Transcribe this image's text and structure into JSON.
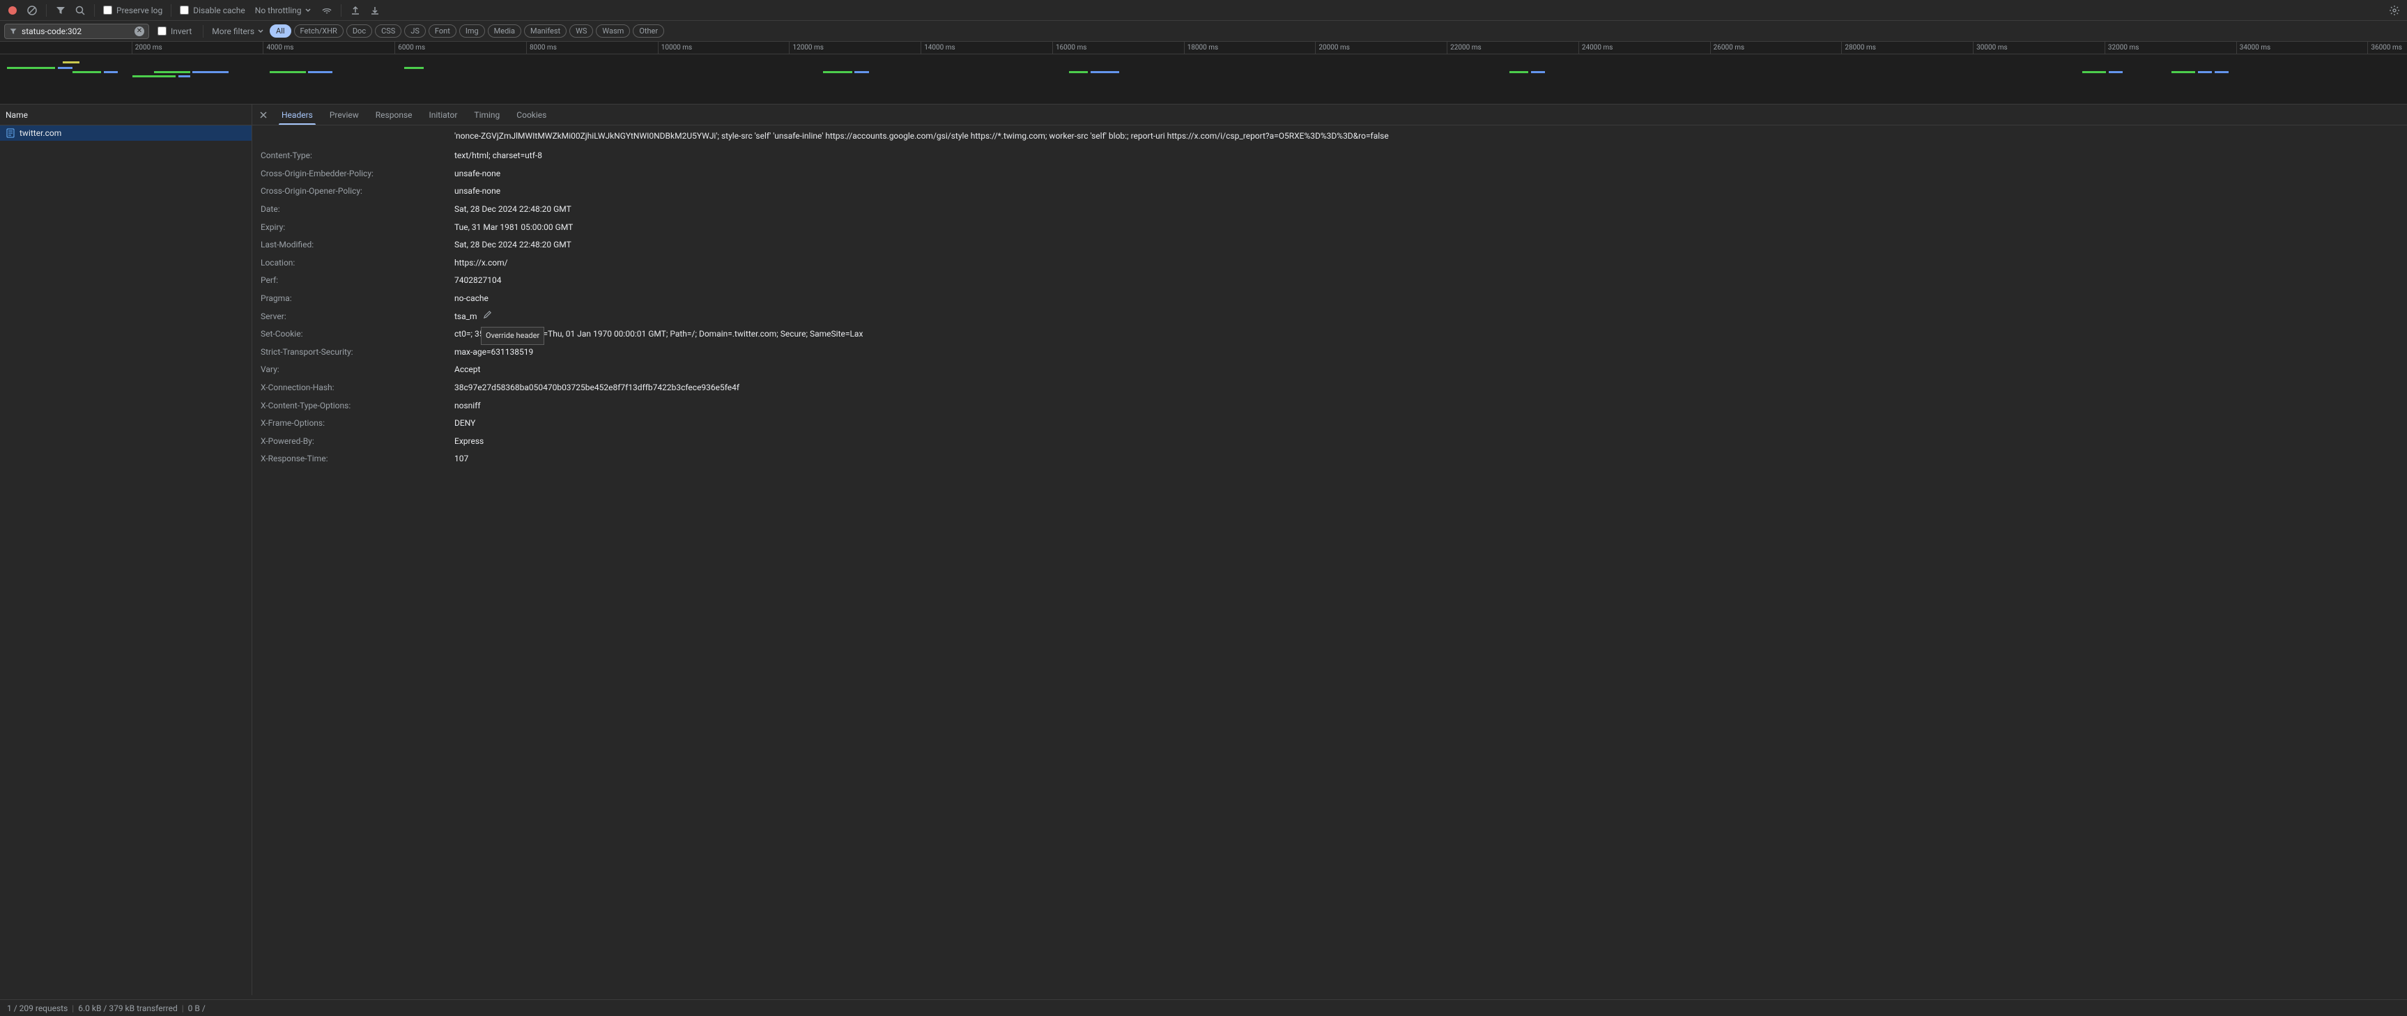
{
  "toolbar": {
    "preserve_log": "Preserve log",
    "disable_cache": "Disable cache",
    "throttling": "No throttling"
  },
  "filter": {
    "value": "status-code:302",
    "invert": "Invert",
    "more_filters": "More filters",
    "pills": [
      "All",
      "Fetch/XHR",
      "Doc",
      "CSS",
      "JS",
      "Font",
      "Img",
      "Media",
      "Manifest",
      "WS",
      "Wasm",
      "Other"
    ]
  },
  "timeline": {
    "ticks": [
      "2000 ms",
      "4000 ms",
      "6000 ms",
      "8000 ms",
      "10000 ms",
      "12000 ms",
      "14000 ms",
      "16000 ms",
      "18000 ms",
      "20000 ms",
      "22000 ms",
      "24000 ms",
      "26000 ms",
      "28000 ms",
      "30000 ms",
      "32000 ms",
      "34000 ms",
      "36000 ms"
    ]
  },
  "columns": {
    "name": "Name"
  },
  "requests": [
    {
      "name": "twitter.com",
      "type": "doc"
    }
  ],
  "details": {
    "tabs": [
      "Headers",
      "Preview",
      "Response",
      "Initiator",
      "Timing",
      "Cookies"
    ],
    "csp_value": "'nonce-ZGVjZmJlMWItMWZkMi00ZjhiLWJkNGYtNWI0NDBkM2U5YWJi'; style-src 'self' 'unsafe-inline' https://accounts.google.com/gsi/style https://*.twimg.com; worker-src 'self' blob:; report-uri https://x.com/i/csp_report?a=O5RXE%3D%3D%3D&ro=false",
    "headers": [
      {
        "name": "Content-Type:",
        "value": "text/html; charset=utf-8"
      },
      {
        "name": "Cross-Origin-Embedder-Policy:",
        "value": "unsafe-none"
      },
      {
        "name": "Cross-Origin-Opener-Policy:",
        "value": "unsafe-none"
      },
      {
        "name": "Date:",
        "value": "Sat, 28 Dec 2024 22:48:20 GMT"
      },
      {
        "name": "Expiry:",
        "value": "Tue, 31 Mar 1981 05:00:00 GMT"
      },
      {
        "name": "Last-Modified:",
        "value": "Sat, 28 Dec 2024 22:48:20 GMT"
      },
      {
        "name": "Location:",
        "value": "https://x.com/"
      },
      {
        "name": "Perf:",
        "value": "7402827104"
      },
      {
        "name": "Pragma:",
        "value": "no-cache"
      },
      {
        "name": "Server:",
        "value": "tsa_m",
        "editable": true
      },
      {
        "name": "Set-Cookie:",
        "value": "ct0=;                          35426099; Expires=Thu, 01 Jan 1970 00:00:01 GMT; Path=/; Domain=.twitter.com; Secure; SameSite=Lax",
        "tooltip": true
      },
      {
        "name": "Strict-Transport-Security:",
        "value": "max-age=631138519"
      },
      {
        "name": "Vary:",
        "value": "Accept"
      },
      {
        "name": "X-Connection-Hash:",
        "value": "38c97e27d58368ba050470b03725be452e8f7f13dffb7422b3cfece936e5fe4f"
      },
      {
        "name": "X-Content-Type-Options:",
        "value": "nosniff"
      },
      {
        "name": "X-Frame-Options:",
        "value": "DENY"
      },
      {
        "name": "X-Powered-By:",
        "value": "Express"
      },
      {
        "name": "X-Response-Time:",
        "value": "107"
      }
    ],
    "tooltip": "Override header"
  },
  "status": {
    "requests": "1 / 209 requests",
    "transferred": "6.0 kB / 379 kB transferred",
    "resources": "0 B /"
  }
}
